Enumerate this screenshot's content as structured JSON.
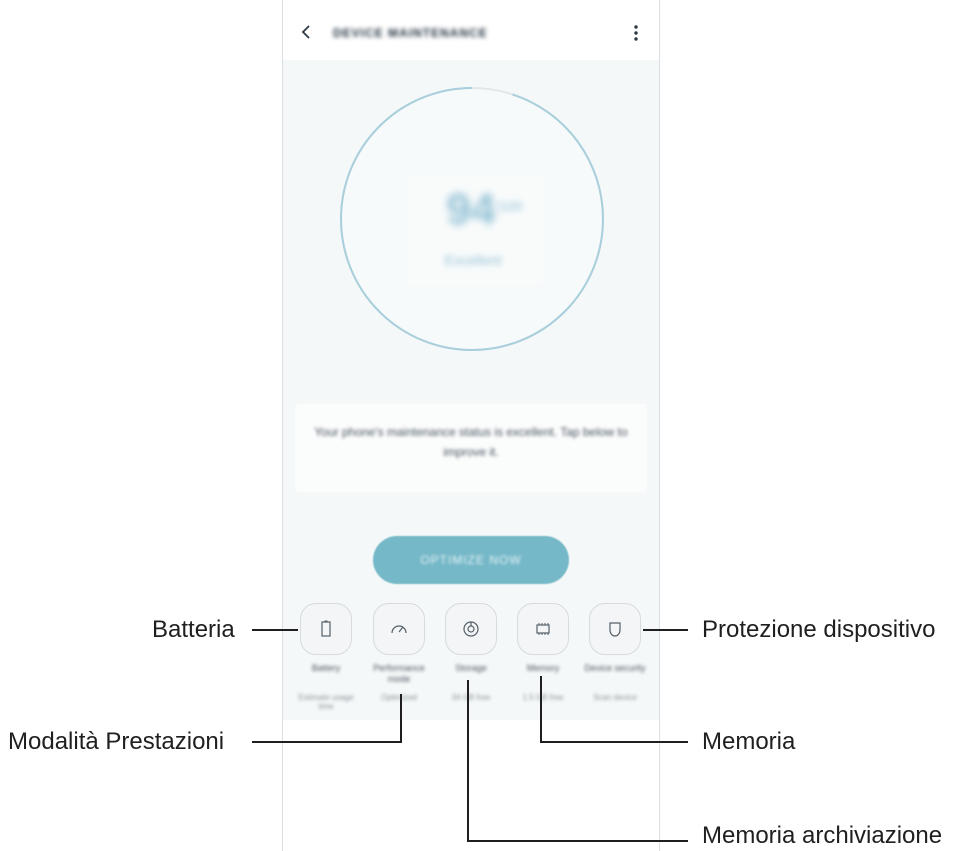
{
  "app": {
    "title": "DEVICE MAINTENANCE",
    "score": "94",
    "score_unit": "/100",
    "score_status": "Excellent",
    "status_message": "Your phone's maintenance status is excellent. Tap below to improve it.",
    "optimize_label": "OPTIMIZE NOW",
    "ring_progress_fraction": 0.95
  },
  "tiles": [
    {
      "label": "Battery",
      "sub": "Estimate usage time",
      "icon": "battery-icon"
    },
    {
      "label": "Performance mode",
      "sub": "Optimized",
      "icon": "speedometer-icon"
    },
    {
      "label": "Storage",
      "sub": "34 GB free",
      "icon": "storage-pie-icon"
    },
    {
      "label": "Memory",
      "sub": "1.5 GB free",
      "icon": "memory-chip-icon"
    },
    {
      "label": "Device security",
      "sub": "Scan device",
      "icon": "shield-icon"
    }
  ],
  "callouts": {
    "battery": "Batteria",
    "performance": "Modalità Prestazioni",
    "storage": "Memoria archiviazione",
    "memory": "Memoria",
    "security": "Protezione dispositivo"
  },
  "colors": {
    "accent": "#75b8c8",
    "ring": "#a9cfdc",
    "background": "#f5f8f8",
    "callout_line": "#1f1f1f"
  }
}
